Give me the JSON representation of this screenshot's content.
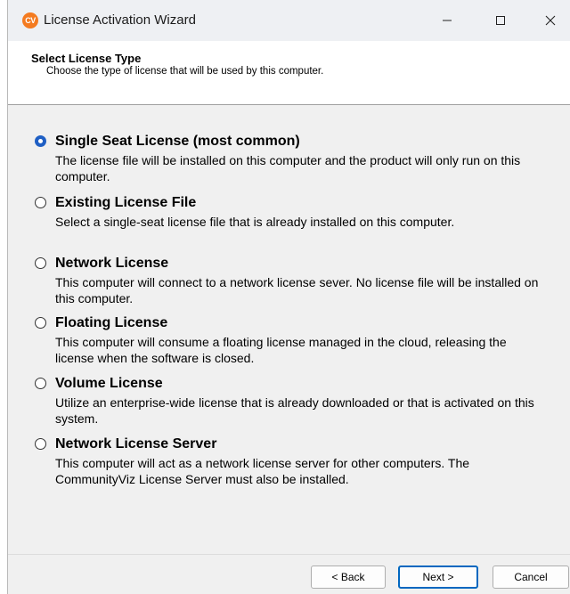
{
  "window": {
    "title": "License Activation Wizard",
    "icon_text": "CV"
  },
  "header": {
    "title": "Select License Type",
    "subtitle": "Choose the type of license that will be used by this computer."
  },
  "options": [
    {
      "label": "Single Seat License (most common)",
      "description": "The license file will be installed on this computer and the product will only run on this computer.",
      "selected": true
    },
    {
      "label": "Existing License File",
      "description": "Select a single-seat license file that is already installed on this computer.",
      "selected": false
    },
    {
      "label": "Network License",
      "description": "This computer will connect to a network license sever.  No license file will be installed on this computer.",
      "selected": false
    },
    {
      "label": "Floating License",
      "description": "This computer will consume a floating license managed in the cloud, releasing the license when the software is closed.",
      "selected": false
    },
    {
      "label": "Volume License",
      "description": "Utilize an enterprise-wide license that is already downloaded or that is activated on this system.",
      "selected": false
    },
    {
      "label": "Network License Server",
      "description": "This computer will act as a network license server for other computers. The CommunityViz License Server must also be installed.",
      "selected": false
    }
  ],
  "buttons": {
    "back": "< Back",
    "next": "Next >",
    "cancel": "Cancel"
  },
  "colors": {
    "accent": "#1f5fc4",
    "app_icon": "#f47b20"
  }
}
